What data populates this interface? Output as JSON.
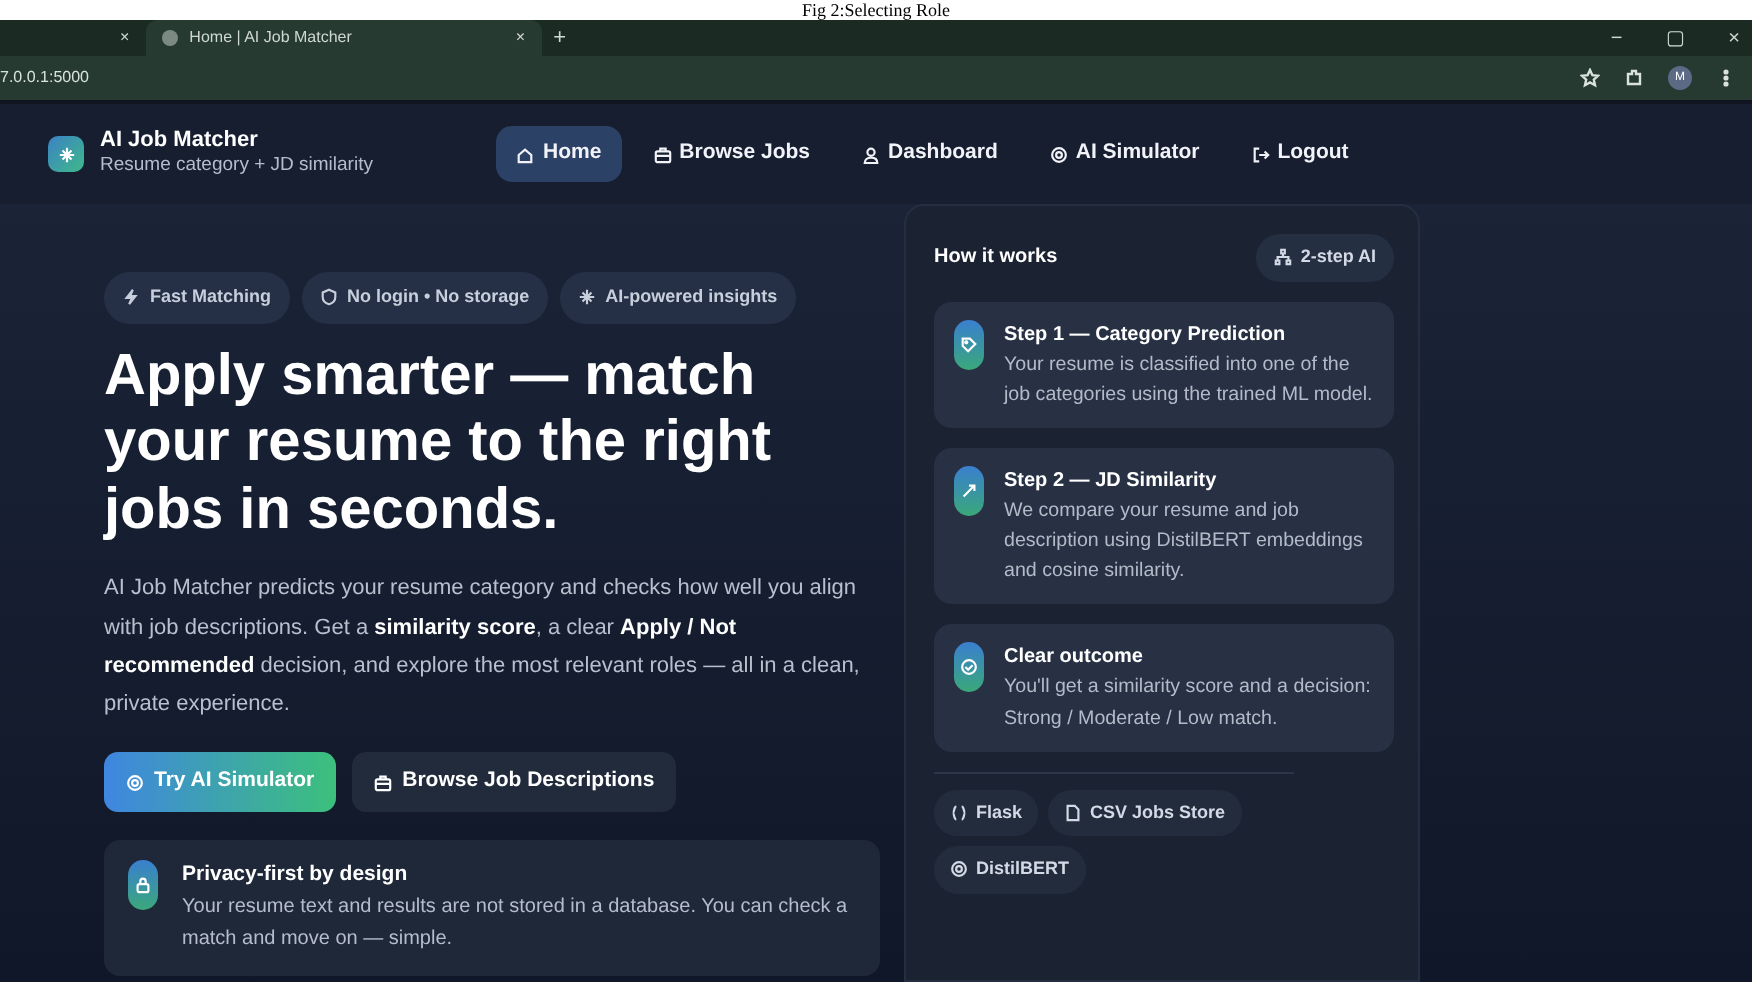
{
  "caption": "Fig 2:Selecting Role",
  "browser": {
    "tabs": [
      {
        "close": "×",
        "selected": false
      },
      {
        "title": "Home | AI Job Matcher",
        "close": "×",
        "selected": true
      }
    ],
    "new_tab": "+",
    "address": "7.0.0.1:5000",
    "profile": "M",
    "window_controls": [
      "−",
      "▢",
      "×"
    ]
  },
  "app": {
    "brand": "AI Job Matcher",
    "subtitle": "Resume category + JD similarity",
    "nav": [
      {
        "label": "Home",
        "selected": true
      },
      {
        "label": "Browse Jobs",
        "selected": false
      },
      {
        "label": "Dashboard",
        "selected": false
      },
      {
        "label": "AI Simulator",
        "selected": false
      },
      {
        "label": "Logout",
        "selected": false
      }
    ]
  },
  "hero": {
    "chips": [
      "Fast Matching",
      "No login • No storage",
      "AI-powered insights"
    ],
    "heading": "Apply smarter — match your resume to the right jobs in seconds.",
    "paragraph": "AI Job Matcher predicts your resume category and checks how well you align with job descriptions. Get a **similarity score**, a clear **Apply / Not recommended** decision, and explore the most relevant roles — all in a clean, private experience.",
    "buttons": [
      {
        "label": "Try AI Simulator",
        "kind": "primary"
      },
      {
        "label": "Browse Job Descriptions",
        "kind": "secondary"
      }
    ],
    "privacy": {
      "title": "Privacy-first by design",
      "text": "Your resume text and results are not stored in a database. You can check a match and move on — simple."
    }
  },
  "how": {
    "title": "How it works",
    "badge": "2-step AI",
    "steps": [
      {
        "title": "Step 1 — Category Prediction",
        "text": "Your resume is classified into one of the job categories using the trained ML model."
      },
      {
        "title": "Step 2 — JD Similarity",
        "text": "We compare your resume and job description using DistilBERT embeddings and cosine similarity."
      },
      {
        "title": "Clear outcome",
        "text": "You'll get a similarity score and a decision: Strong / Moderate / Low match."
      }
    ],
    "tech": [
      "Flask",
      "CSV Jobs Store",
      "DistilBERT"
    ]
  }
}
